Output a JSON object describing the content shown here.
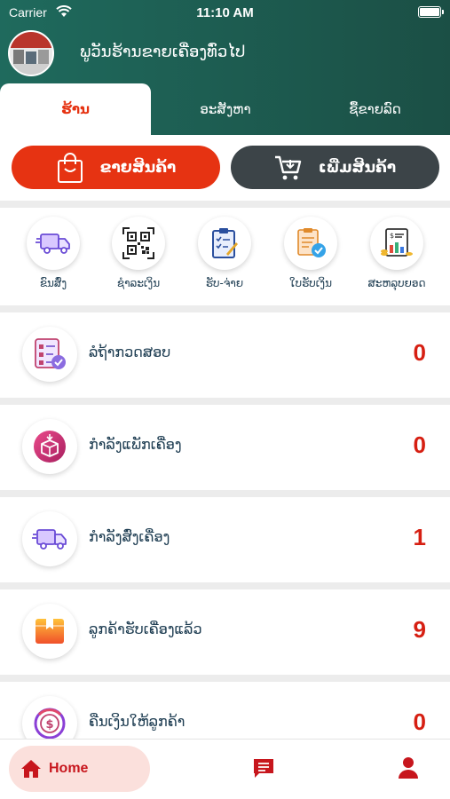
{
  "status_bar": {
    "carrier": "Carrier",
    "time": "11:10 AM"
  },
  "header": {
    "shop_title": "ພູວັນຮ້ານຂາຍເຄື່ອງທົ່ວໄປ"
  },
  "tabs": [
    {
      "label": "ຮ້ານ",
      "active": true
    },
    {
      "label": "ອະສັງຫາ",
      "active": false
    },
    {
      "label": "ຊື້ຂາຍລົດ",
      "active": false
    }
  ],
  "actions": {
    "sell_label": "ຂາຍສິນຄ້າ",
    "add_label": "ເພີ່ມສິນຄ້າ"
  },
  "quick_menu": [
    {
      "label": "ຂົນສົ່ງ",
      "icon": "delivery-truck-icon"
    },
    {
      "label": "ຊໍາລະເງິນ",
      "icon": "qr-code-icon"
    },
    {
      "label": "ຮັບ-ຈ່າຍ",
      "icon": "clipboard-checklist-icon"
    },
    {
      "label": "ໃບຮັບເງິນ",
      "icon": "receipt-check-icon"
    },
    {
      "label": "ສະຫລຸບຍອດ",
      "icon": "report-summary-icon"
    }
  ],
  "order_statuses": [
    {
      "label": "ລໍຖ້າກວດສອບ",
      "count": "0",
      "icon": "checklist-review-icon"
    },
    {
      "label": "ກໍາລັງແພັກເຄື່ອງ",
      "count": "0",
      "icon": "packing-box-icon"
    },
    {
      "label": "ກໍາລັງສົ່ງເຄື່ອງ",
      "count": "1",
      "icon": "delivery-truck-icon"
    },
    {
      "label": "ລູກຄ້າຮັບເຄື່ອງແລ້ວ",
      "count": "9",
      "icon": "received-package-icon"
    },
    {
      "label": "ຄືນເງິນໃຫ້ລູກຄ້າ",
      "count": "0",
      "icon": "refund-dollar-icon"
    }
  ],
  "bottom_nav": {
    "home_label": "Home"
  },
  "colors": {
    "header_green": "#1f6a5d",
    "accent_red": "#e63312",
    "dark_button": "#3c4448",
    "count_red": "#d61f12",
    "home_pill": "#fbe0dc"
  }
}
